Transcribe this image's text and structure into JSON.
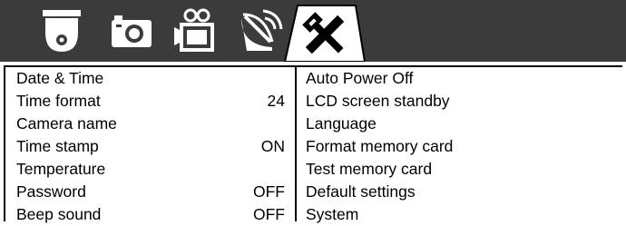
{
  "tabs": [
    {
      "icon": "security-camera-icon",
      "active": false
    },
    {
      "icon": "photo-camera-icon",
      "active": false
    },
    {
      "icon": "video-camera-icon",
      "active": false
    },
    {
      "icon": "wireless-satellite-icon",
      "active": false
    },
    {
      "icon": "tools-settings-icon",
      "active": true
    }
  ],
  "colors": {
    "tabbar_bg": "#3b3b3b",
    "icon_fill": "#ffffff",
    "active_tab_bg": "#ffffff"
  },
  "left_items": [
    {
      "label": "Date & Time",
      "value": ""
    },
    {
      "label": "Time format",
      "value": "24"
    },
    {
      "label": "Camera name",
      "value": ""
    },
    {
      "label": "Time stamp",
      "value": "ON"
    },
    {
      "label": "Temperature",
      "value": ""
    },
    {
      "label": "Password",
      "value": "OFF"
    },
    {
      "label": "Beep sound",
      "value": "OFF"
    }
  ],
  "right_items": [
    {
      "label": "Auto Power Off"
    },
    {
      "label": "LCD screen standby"
    },
    {
      "label": "Language"
    },
    {
      "label": "Format memory card"
    },
    {
      "label": "Test memory card"
    },
    {
      "label": "Default settings"
    },
    {
      "label": "System"
    }
  ]
}
